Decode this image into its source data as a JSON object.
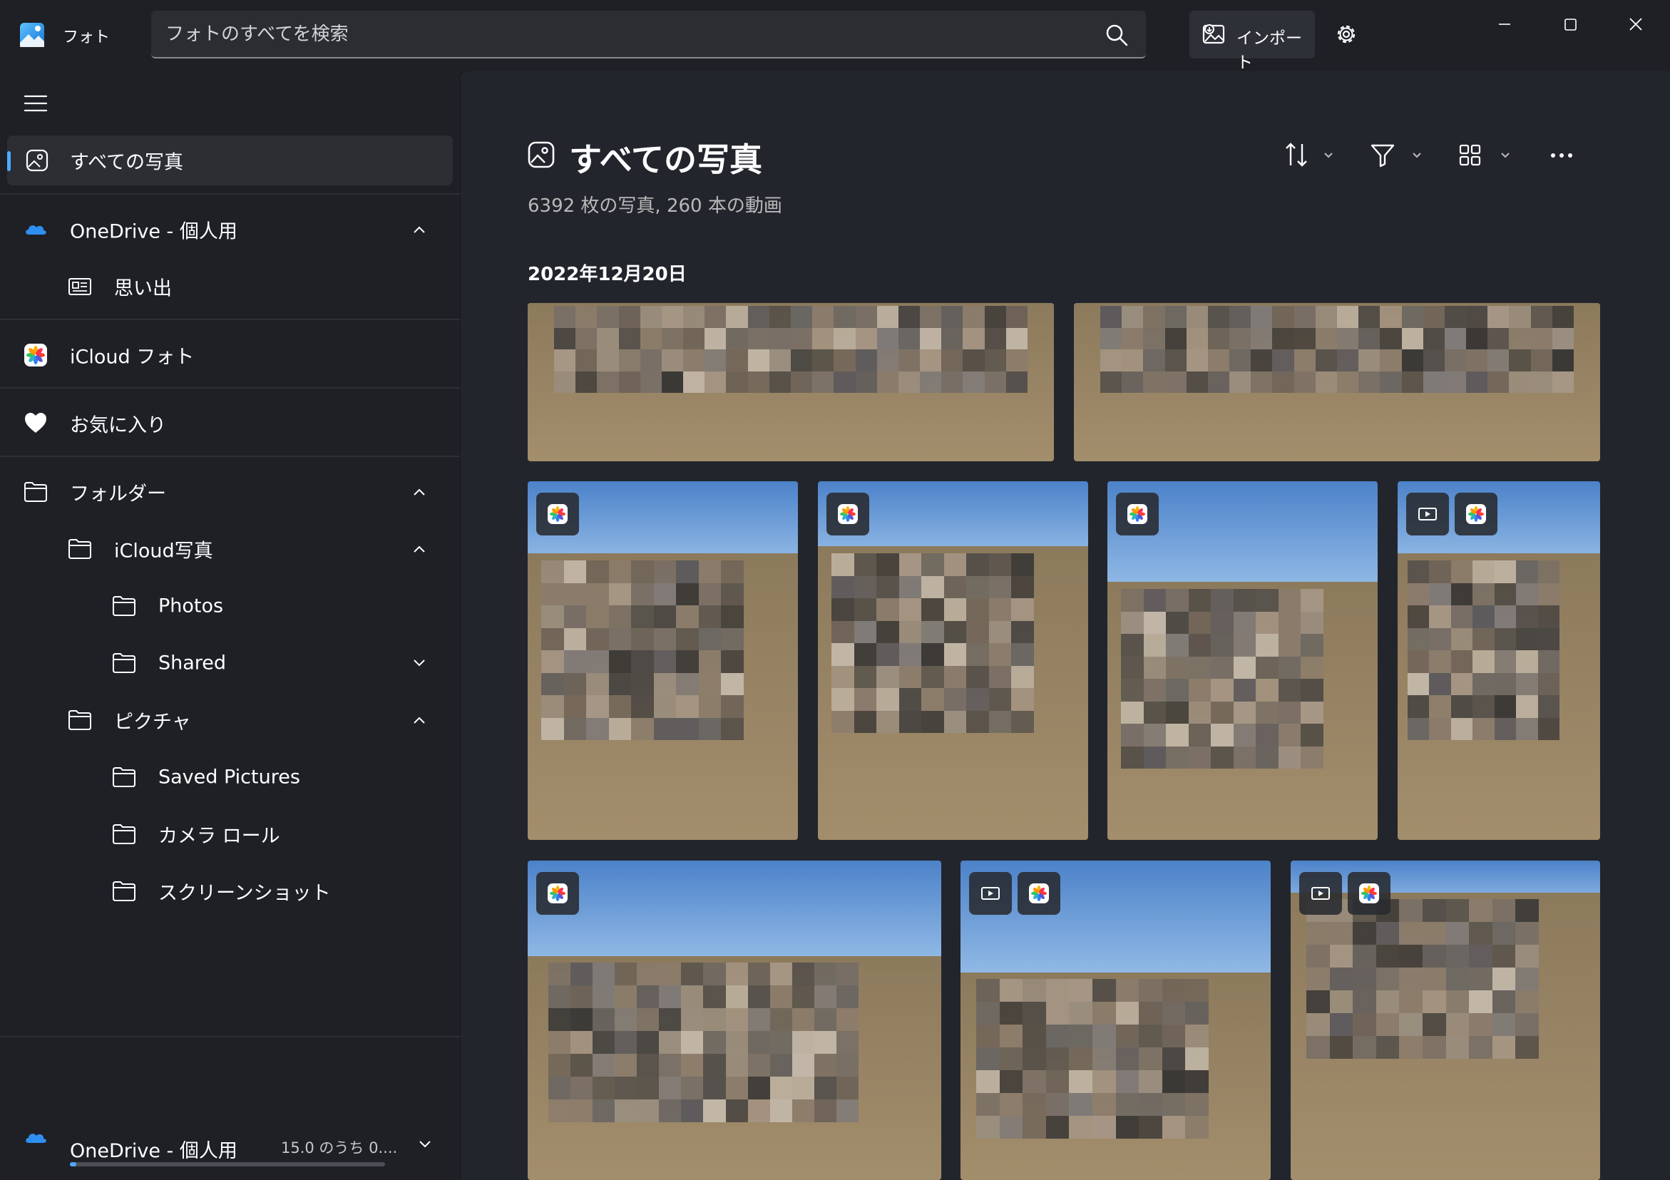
{
  "app": {
    "name": "フォト"
  },
  "search": {
    "placeholder": "フォトのすべてを検索"
  },
  "toolbar": {
    "import_label": "インポート"
  },
  "sidebar": {
    "all_photos": "すべての写真",
    "onedrive": "OneDrive - 個人用",
    "memories": "思い出",
    "icloud": "iCloud フォト",
    "favorites": "お気に入り",
    "folders": "フォルダー",
    "icloud_folder": "iCloud写真",
    "photos": "Photos",
    "shared": "Shared",
    "pictures": "ピクチャ",
    "saved_pictures": "Saved Pictures",
    "camera_roll": "カメラ ロール",
    "screenshots": "スクリーンショット"
  },
  "storage": {
    "label": "OneDrive - 個人用",
    "usage": "15.0 のうち 0....",
    "used_fraction": 0.02
  },
  "main": {
    "title": "すべての写真",
    "subtitle": "6392 枚の写真, 260 本の動画",
    "date_group": "2022年12月20日"
  },
  "colors": {
    "accent": "#4fa9ff",
    "background": "#22252c",
    "sidebar": "#1e2026"
  }
}
